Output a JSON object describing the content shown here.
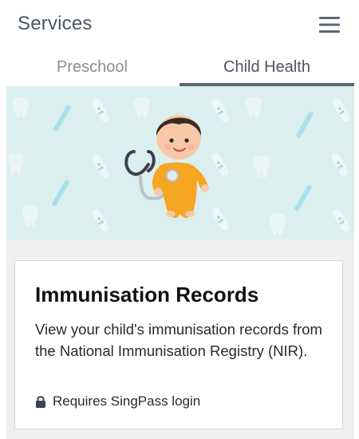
{
  "header": {
    "title": "Services",
    "menu_icon": "hamburger-menu-icon"
  },
  "tabs": [
    {
      "label": "Preschool",
      "active": false
    },
    {
      "label": "Child Health",
      "active": true
    }
  ],
  "banner": {
    "illustration": "baby-with-stethoscope",
    "pattern_icons": [
      "tooth-icon",
      "bandage-icon",
      "toothbrush-icon"
    ],
    "background_color": "#dcefef"
  },
  "card": {
    "title": "Immunisation Records",
    "description": "View your child's immunisation records from the National Immunisation Registry (NIR).",
    "login_note": "Requires SingPass login",
    "lock_icon": "lock-icon"
  },
  "colors": {
    "header_text": "#4e5563",
    "tab_active_underline": "#5d6578",
    "baby_outfit": "#f5a623"
  }
}
